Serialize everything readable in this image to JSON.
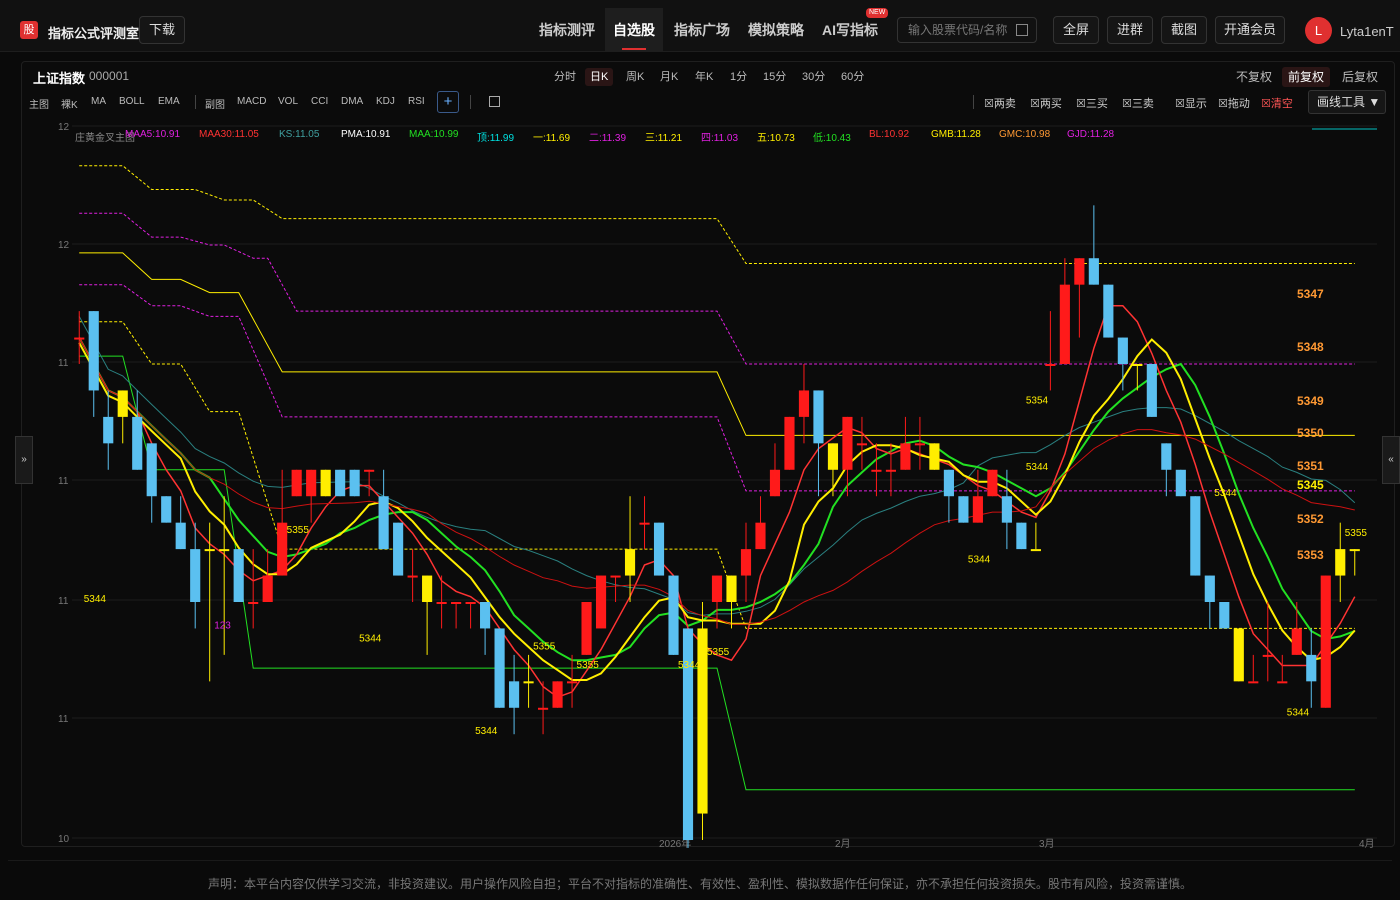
{
  "app": {
    "logo_char": "股",
    "title": "指标公式评测室",
    "download": "下载"
  },
  "nav": {
    "items": [
      "指标测评",
      "自选股",
      "指标广场",
      "模拟策略",
      "AI写指标"
    ],
    "active_index": 1,
    "new_badge": "NEW"
  },
  "search": {
    "placeholder": "输入股票代码/名称"
  },
  "header_buttons": [
    "全屏",
    "进群",
    "截图",
    "开通会员"
  ],
  "user": {
    "avatar_letter": "L",
    "name": "Lyta1enT"
  },
  "stock": {
    "name": "上证指数",
    "code": "000001"
  },
  "periods": [
    "分时",
    "日K",
    "周K",
    "月K",
    "年K",
    "1分",
    "15分",
    "30分",
    "60分"
  ],
  "period_active": 1,
  "adjust": [
    "不复权",
    "前复权",
    "后复权"
  ],
  "adjust_active": 1,
  "indicators_main": [
    "主图",
    "裸K",
    "MA",
    "BOLL",
    "EMA"
  ],
  "indicators_sub": [
    "副图",
    "MACD",
    "VOL",
    "CCI",
    "DMA",
    "KDJ",
    "RSI"
  ],
  "right_tools": [
    "两卖",
    "两买",
    "三买",
    "三卖",
    "显示",
    "拖动",
    "清空"
  ],
  "draw_tool": "画线工具",
  "colors": {
    "up": "#ff1a1a",
    "down": "#5bc0f0",
    "yellow": "#ffee00",
    "green": "#22e022",
    "magenta": "#e020e0",
    "orange": "#ff9933",
    "accent": "#e03030"
  },
  "legend": [
    {
      "text": "庄黄金叉主图",
      "color": "#888888"
    },
    {
      "text": "MAA5:10.91",
      "color": "#e020e0"
    },
    {
      "text": "MAA30:11.05",
      "color": "#ff3333"
    },
    {
      "text": "KS:11.05",
      "color": "#40a0a0"
    },
    {
      "text": "PMA:10.91",
      "color": "#ffffff"
    },
    {
      "text": "MAA:10.99",
      "color": "#22e022"
    },
    {
      "text": "顶:11.99",
      "color": "#00e0e0"
    },
    {
      "text": "一:11.69",
      "color": "#ffee00"
    },
    {
      "text": "二:11.39",
      "color": "#e020e0"
    },
    {
      "text": "三:11.21",
      "color": "#ffee00"
    },
    {
      "text": "四:11.03",
      "color": "#e020e0"
    },
    {
      "text": "五:10.73",
      "color": "#ffee00"
    },
    {
      "text": "低:10.43",
      "color": "#22e022"
    },
    {
      "text": "BL:10.92",
      "color": "#ff3333"
    },
    {
      "text": "GMB:11.28",
      "color": "#ffee00"
    },
    {
      "text": "GMC:10.98",
      "color": "#ff9933"
    },
    {
      "text": "GJD:11.28",
      "color": "#e020e0"
    }
  ],
  "chart_data": {
    "type": "candlestick",
    "y_tick_labels": [
      "12",
      "12",
      "11",
      "11",
      "11",
      "11",
      "10"
    ],
    "x_tick_labels": [
      "2026年",
      "2月",
      "3月",
      "4月"
    ],
    "candles": [
      [
        11.4,
        11.4,
        11.3,
        11.5
      ],
      [
        11.5,
        11.2,
        11.1,
        11.5
      ],
      [
        11.1,
        11.0,
        10.9,
        11.2
      ],
      [
        11.2,
        11.1,
        11.0,
        11.2
      ],
      [
        11.1,
        10.9,
        10.9,
        11.2
      ],
      [
        11.0,
        10.8,
        10.7,
        11.0
      ],
      [
        10.8,
        10.7,
        10.7,
        10.8
      ],
      [
        10.7,
        10.6,
        10.6,
        10.8
      ],
      [
        10.6,
        10.4,
        10.3,
        10.7
      ],
      [
        10.6,
        10.6,
        10.1,
        10.7
      ],
      [
        10.6,
        10.6,
        10.2,
        10.8
      ],
      [
        10.6,
        10.4,
        10.4,
        10.6
      ],
      [
        10.4,
        10.4,
        10.3,
        10.6
      ],
      [
        10.4,
        10.5,
        10.4,
        10.6
      ],
      [
        10.5,
        10.7,
        10.5,
        10.9
      ],
      [
        10.8,
        10.9,
        10.8,
        10.9
      ],
      [
        10.8,
        10.9,
        10.7,
        10.9
      ],
      [
        10.9,
        10.8,
        10.8,
        10.9
      ],
      [
        10.9,
        10.8,
        10.8,
        10.9
      ],
      [
        10.9,
        10.8,
        10.8,
        10.9
      ],
      [
        10.9,
        10.9,
        10.8,
        10.9
      ],
      [
        10.8,
        10.6,
        10.6,
        10.9
      ],
      [
        10.7,
        10.5,
        10.5,
        10.7
      ],
      [
        10.5,
        10.5,
        10.4,
        10.6
      ],
      [
        10.5,
        10.4,
        10.2,
        10.5
      ],
      [
        10.4,
        10.4,
        10.3,
        10.5
      ],
      [
        10.4,
        10.4,
        10.3,
        10.4
      ],
      [
        10.4,
        10.4,
        10.3,
        10.4
      ],
      [
        10.4,
        10.3,
        10.2,
        10.4
      ],
      [
        10.3,
        10.0,
        10.0,
        10.3
      ],
      [
        10.1,
        10.0,
        9.9,
        10.2
      ],
      [
        10.1,
        10.1,
        10.0,
        10.2
      ],
      [
        10.0,
        10.0,
        9.9,
        10.1
      ],
      [
        10.0,
        10.1,
        10.0,
        10.1
      ],
      [
        10.1,
        10.1,
        10.0,
        10.2
      ],
      [
        10.2,
        10.4,
        10.2,
        10.4
      ],
      [
        10.3,
        10.5,
        10.3,
        10.5
      ],
      [
        10.5,
        10.5,
        10.4,
        10.5
      ],
      [
        10.5,
        10.6,
        10.4,
        10.8
      ],
      [
        10.7,
        10.7,
        10.6,
        10.8
      ],
      [
        10.7,
        10.5,
        10.5,
        10.7
      ],
      [
        10.5,
        10.2,
        10.2,
        10.5
      ],
      [
        10.3,
        9.5,
        9.4,
        10.3
      ],
      [
        9.6,
        10.3,
        9.5,
        10.4
      ],
      [
        10.4,
        10.5,
        10.3,
        10.5
      ],
      [
        10.5,
        10.4,
        10.3,
        10.5
      ],
      [
        10.5,
        10.6,
        10.4,
        10.7
      ],
      [
        10.6,
        10.7,
        10.6,
        10.8
      ],
      [
        10.8,
        10.9,
        10.8,
        11.0
      ],
      [
        10.9,
        11.1,
        10.9,
        11.1
      ],
      [
        11.1,
        11.2,
        11.0,
        11.3
      ],
      [
        11.2,
        11.0,
        10.8,
        11.2
      ],
      [
        11.0,
        10.9,
        10.8,
        11.0
      ],
      [
        10.9,
        11.1,
        10.8,
        11.1
      ],
      [
        11.0,
        11.0,
        10.9,
        11.1
      ],
      [
        10.9,
        10.9,
        10.8,
        11.0
      ],
      [
        10.9,
        10.9,
        10.8,
        11.0
      ],
      [
        10.9,
        11.0,
        10.9,
        11.1
      ],
      [
        11.0,
        11.0,
        10.9,
        11.1
      ],
      [
        11.0,
        10.9,
        10.9,
        11.0
      ],
      [
        10.9,
        10.8,
        10.7,
        10.9
      ],
      [
        10.8,
        10.7,
        10.7,
        10.8
      ],
      [
        10.7,
        10.8,
        10.7,
        10.9
      ],
      [
        10.8,
        10.9,
        10.8,
        10.9
      ],
      [
        10.8,
        10.7,
        10.6,
        10.9
      ],
      [
        10.7,
        10.6,
        10.6,
        10.7
      ],
      [
        10.6,
        10.6,
        10.6,
        10.7
      ],
      [
        11.3,
        11.3,
        11.2,
        11.5
      ],
      [
        11.3,
        11.6,
        11.3,
        11.7
      ],
      [
        11.6,
        11.7,
        11.4,
        11.7
      ],
      [
        11.7,
        11.6,
        11.6,
        11.9
      ],
      [
        11.6,
        11.4,
        11.4,
        11.6
      ],
      [
        11.4,
        11.3,
        11.2,
        11.4
      ],
      [
        11.3,
        11.3,
        11.2,
        11.3
      ],
      [
        11.3,
        11.1,
        11.1,
        11.3
      ],
      [
        11.0,
        10.9,
        10.8,
        11.0
      ],
      [
        10.9,
        10.8,
        10.8,
        10.9
      ],
      [
        10.8,
        10.5,
        10.5,
        10.8
      ],
      [
        10.5,
        10.4,
        10.3,
        10.5
      ],
      [
        10.4,
        10.3,
        10.3,
        10.4
      ],
      [
        10.3,
        10.1,
        10.1,
        10.3
      ],
      [
        10.1,
        10.1,
        10.1,
        10.2
      ],
      [
        10.2,
        10.2,
        10.1,
        10.4
      ],
      [
        10.1,
        10.1,
        10.1,
        10.2
      ],
      [
        10.2,
        10.3,
        10.2,
        10.4
      ],
      [
        10.2,
        10.1,
        10.0,
        10.3
      ],
      [
        10.0,
        10.5,
        10.0,
        10.5
      ],
      [
        10.5,
        10.6,
        10.4,
        10.7
      ],
      [
        10.6,
        10.6,
        10.5,
        10.6
      ]
    ],
    "labels": [
      {
        "i": 1,
        "v": 10.4,
        "text": "5344",
        "color": "#ffee00"
      },
      {
        "i": 10,
        "v": 10.3,
        "text": "123",
        "color": "#e020e0"
      },
      {
        "i": 15,
        "v": 10.66,
        "text": "5355",
        "color": "#ffee00"
      },
      {
        "i": 20,
        "v": 10.25,
        "text": "5344",
        "color": "#ffee00"
      },
      {
        "i": 28,
        "v": 9.9,
        "text": "5344",
        "color": "#ffee00"
      },
      {
        "i": 32,
        "v": 10.22,
        "text": "5355",
        "color": "#ffee00"
      },
      {
        "i": 35,
        "v": 10.15,
        "text": "5355",
        "color": "#ffee00"
      },
      {
        "i": 42,
        "v": 10.15,
        "text": "5344",
        "color": "#ffee00"
      },
      {
        "i": 44,
        "v": 10.2,
        "text": "5355",
        "color": "#ffee00"
      },
      {
        "i": 62,
        "v": 10.55,
        "text": "5344",
        "color": "#ffee00"
      },
      {
        "i": 66,
        "v": 11.15,
        "text": "5354",
        "color": "#ffee00"
      },
      {
        "i": 66,
        "v": 10.9,
        "text": "5344",
        "color": "#ffee00"
      },
      {
        "i": 79,
        "v": 10.8,
        "text": "5344",
        "color": "#ffee00"
      },
      {
        "i": 84,
        "v": 9.97,
        "text": "5344",
        "color": "#ffee00"
      },
      {
        "i": 88,
        "v": 10.65,
        "text": "5355",
        "color": "#ffee00"
      }
    ],
    "right_levels": [
      {
        "text": "5347",
        "color": "#ff9933"
      },
      {
        "text": "5348",
        "color": "#ff9933"
      },
      {
        "text": "5349",
        "color": "#ff9933"
      },
      {
        "text": "5350",
        "color": "#ff9933"
      },
      {
        "text": "5351",
        "color": "#ff9933"
      },
      {
        "text": "5345",
        "color": "#ffee00"
      },
      {
        "text": "5352",
        "color": "#ff9933"
      },
      {
        "text": "5353",
        "color": "#ff9933"
      }
    ]
  },
  "disclaimer": "声明：本平台内容仅供学习交流，非投资建议。用户操作风险自担；平台不对指标的准确性、有效性、盈利性、模拟数据作任何保证，亦不承担任何投资损失。股市有风险，投资需谨慎。"
}
